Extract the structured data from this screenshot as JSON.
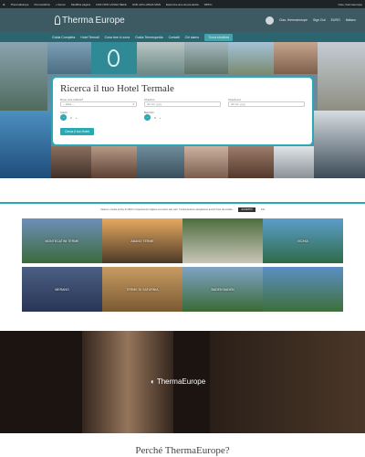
{
  "adminbar": {
    "items": [
      "ThermaEurope",
      "Personalizza",
      "+ Nuovo",
      "Modifica pagina",
      "LINK NON LANGA NELE",
      "LINK with LANGA MGS",
      "Esauri-la-una-nuova-lascia",
      "WPFC"
    ],
    "greeting": "Ciao, thermaeurope"
  },
  "header": {
    "logo_a": "Therma",
    "logo_b": "Europe",
    "user": "Ciao, thermaeurope",
    "links": [
      "Sign Out",
      "EURO",
      "Italiano"
    ]
  },
  "nav": {
    "items": [
      "Guida Completa",
      "Hotel Termali",
      "Cosa fare in zona",
      "Guida Termeopedia",
      "Contatti",
      "Chi siamo",
      "Trova struttura"
    ]
  },
  "search": {
    "title": "Ricerca il tuo Hotel Termale",
    "where_label": "Dove vuoi andare?",
    "where_value": "-- Italia --",
    "checkin_label": "Check-in",
    "checkin_value": "dd mm yyyy",
    "checkout_label": "Check-out",
    "checkout_value": "dd mm yyyy",
    "adults_label": "Adulti",
    "adults_value": "2",
    "children_label": "Bambini",
    "children_value": "0",
    "button": "Cerca il tuo Hotel"
  },
  "cookie": {
    "text": "Usiamo i cookie al fine di offrirti un'esperienza migliore sul nostro sito web. Continuando la navigazione accetti l'uso dei cookie.",
    "accept": "ACCETTO",
    "more": "Info"
  },
  "destinations": [
    {
      "name": "MONTECATINI TERME"
    },
    {
      "name": "ABANO TERME"
    },
    {
      "name": ""
    },
    {
      "name": "ISCHIA"
    },
    {
      "name": "MERANO"
    },
    {
      "name": "TERME DI SATURNIA"
    },
    {
      "name": "BADEN BADEN"
    },
    {
      "name": ""
    }
  ],
  "hero": {
    "logo": "ThermaEurope"
  },
  "below": {
    "heading": "Perché ThermaEurope?"
  },
  "colors": {
    "accent": "#2aa8b4",
    "header": "#3d5a63",
    "nav": "#2b6570"
  }
}
